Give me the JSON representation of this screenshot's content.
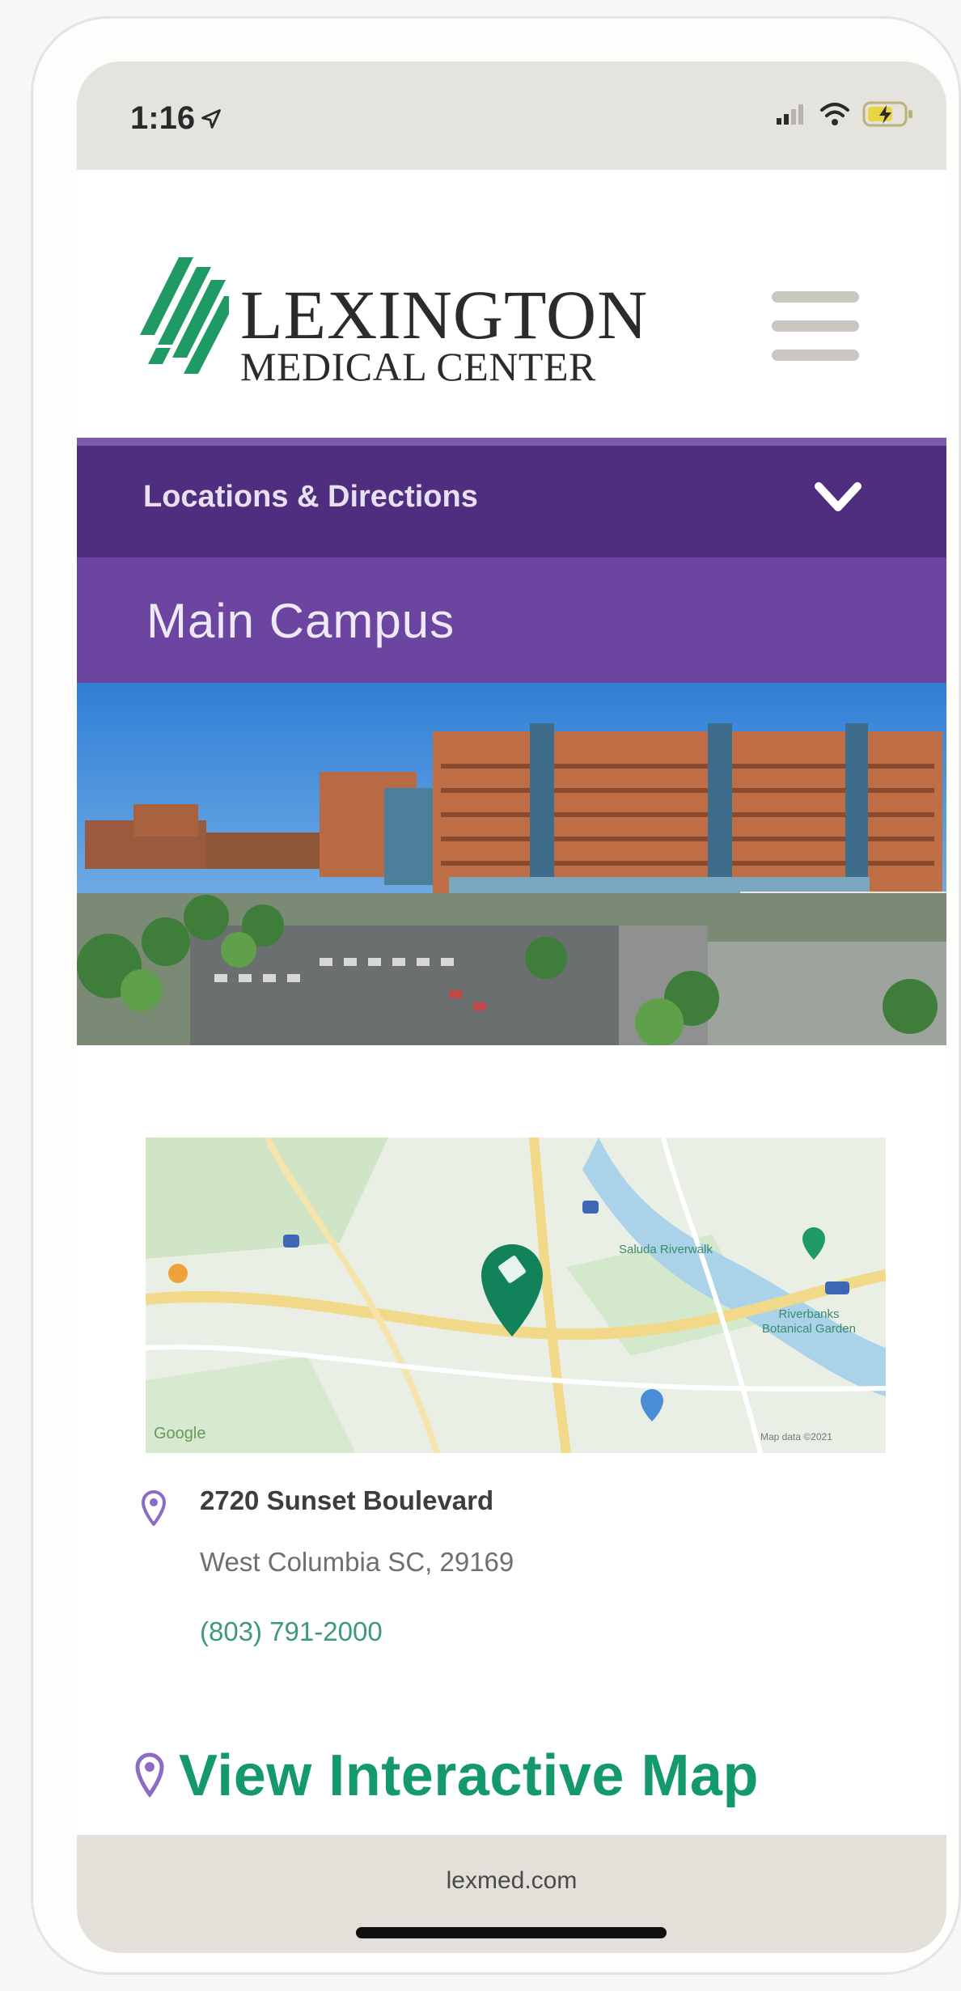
{
  "status_bar": {
    "time": "1:16"
  },
  "header": {
    "logo_line1": "LEXINGTON",
    "logo_line2": "MEDICAL CENTER",
    "brand_color": "#1f9a64"
  },
  "nav": {
    "label": "Locations & Directions",
    "accent_color": "#4f2d7f"
  },
  "page": {
    "title": "Main Campus"
  },
  "map": {
    "labels": {
      "label_1": "Saluda Riverwalk",
      "label_2": "Riverbanks Botanical Garden",
      "label_3": "Google",
      "label_4": "Map data ©2021"
    }
  },
  "address": {
    "line1": "2720 Sunset Boulevard",
    "line2": "West Columbia SC, 29169",
    "phone": "(803) 791-2000"
  },
  "interactive_map": {
    "label": "View Interactive Map"
  },
  "browser": {
    "url": "lexmed.com"
  }
}
